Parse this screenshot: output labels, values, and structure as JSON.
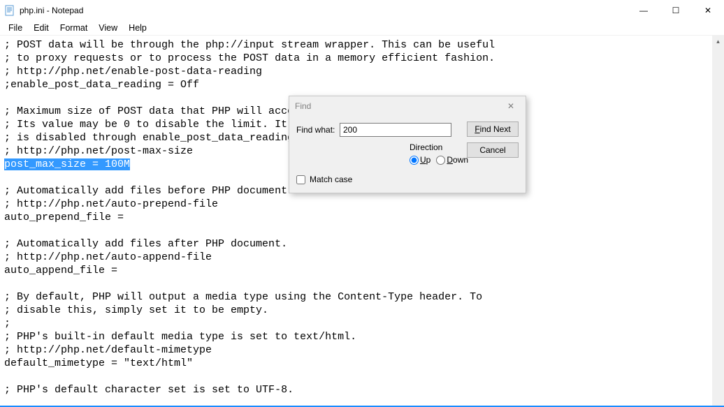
{
  "window": {
    "title": "php.ini - Notepad",
    "controls": {
      "minimize": "—",
      "maximize": "☐",
      "close": "✕"
    }
  },
  "menu": {
    "file": "File",
    "edit": "Edit",
    "format": "Format",
    "view": "View",
    "help": "Help"
  },
  "editor": {
    "lines": [
      "; POST data will be through the php://input stream wrapper. This can be useful",
      "; to proxy requests or to process the POST data in a memory efficient fashion.",
      "; http://php.net/enable-post-data-reading",
      ";enable_post_data_reading = Off",
      "",
      "; Maximum size of POST data that PHP will accept.",
      "; Its value may be 0 to disable the limit. It is ignored if POST data reading",
      "; is disabled through enable_post_data_reading.",
      "; http://php.net/post-max-size",
      "",
      "",
      "; Automatically add files before PHP document.",
      "; http://php.net/auto-prepend-file",
      "auto_prepend_file =",
      "",
      "; Automatically add files after PHP document.",
      "; http://php.net/auto-append-file",
      "auto_append_file =",
      "",
      "; By default, PHP will output a media type using the Content-Type header. To",
      "; disable this, simply set it to be empty.",
      ";",
      "; PHP's built-in default media type is set to text/html.",
      "; http://php.net/default-mimetype",
      "default_mimetype = \"text/html\"",
      "",
      "; PHP's default character set is set to UTF-8."
    ],
    "selected_line": "post_max_size = 100M"
  },
  "find": {
    "title": "Find",
    "close": "✕",
    "label_find_what": "Find what:",
    "value": "200",
    "btn_find_next_pre": "F",
    "btn_find_next_rest": "ind Next",
    "btn_cancel": "Cancel",
    "direction_label": "Direction",
    "radio_up_pre": "U",
    "radio_up_rest": "p",
    "radio_down_pre": "D",
    "radio_down_rest": "own",
    "match_case_pre": "",
    "match_case_rest": "Match case",
    "direction_selected": "up",
    "match_case_checked": false
  }
}
